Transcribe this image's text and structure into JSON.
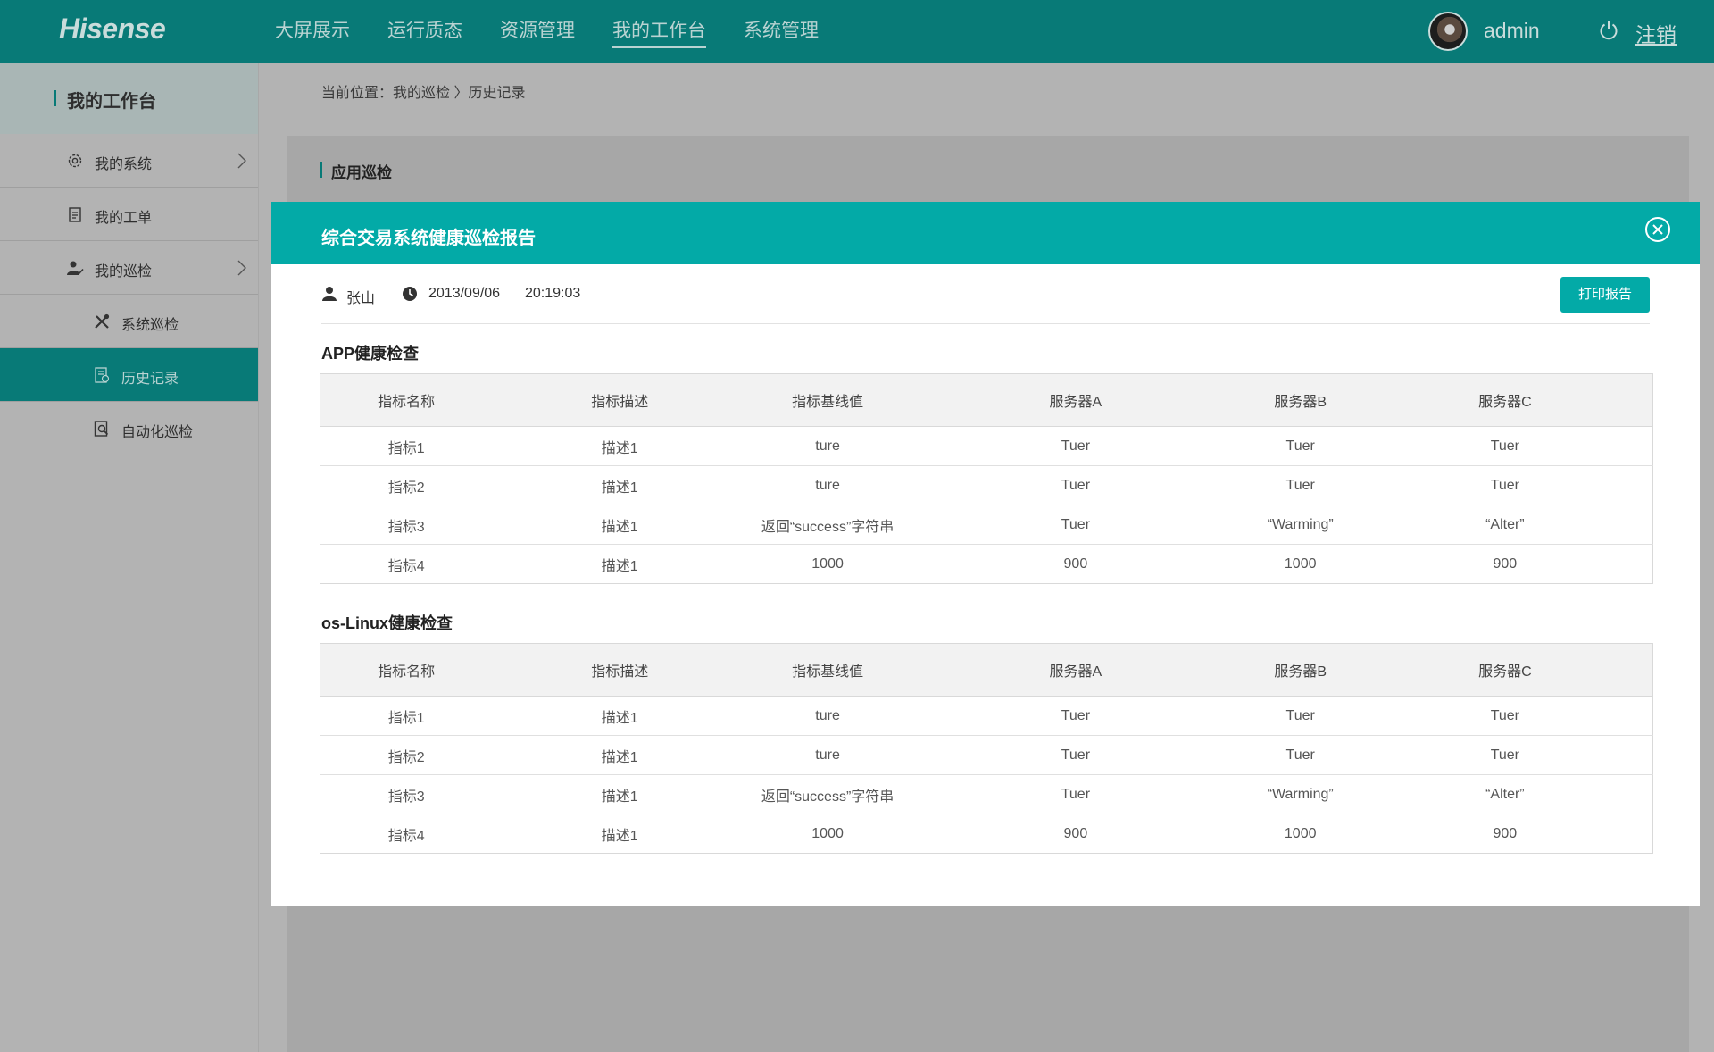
{
  "header": {
    "logo": "Hisense",
    "nav": [
      "大屏展示",
      "运行质态",
      "资源管理",
      "我的工作台",
      "系统管理"
    ],
    "active_nav": "我的工作台",
    "username": "admin",
    "logout": "注销"
  },
  "sidebar": {
    "title": "我的工作台",
    "items": [
      {
        "label": "我的系统",
        "icon": "gear-icon",
        "has_arrow": true
      },
      {
        "label": "我的工单",
        "icon": "clipboard-icon",
        "has_arrow": false
      },
      {
        "label": "我的巡检",
        "icon": "user-check-icon",
        "has_arrow": true
      },
      {
        "label": "系统巡检",
        "icon": "tools-icon",
        "has_arrow": false
      },
      {
        "label": "历史记录",
        "icon": "history-doc-icon",
        "has_arrow": false,
        "active": true
      },
      {
        "label": "自动化巡检",
        "icon": "doc-search-icon",
        "has_arrow": false
      }
    ]
  },
  "breadcrumb": "当前位置：我的巡检 〉历史记录",
  "panel": {
    "title": "应用巡检"
  },
  "modal": {
    "title": "综合交易系统健康巡检报告",
    "inspector": "张山",
    "date": "2013/09/06",
    "time": "20:19:03",
    "print_label": "打印报告",
    "sections": [
      {
        "title": "APP健康检查",
        "headers": [
          "指标名称",
          "指标描述",
          "指标基线值",
          "服务器A",
          "服务器B",
          "服务器C"
        ],
        "rows": [
          [
            "指标1",
            "描述1",
            "ture",
            "Tuer",
            "Tuer",
            "Tuer"
          ],
          [
            "指标2",
            "描述1",
            "ture",
            "Tuer",
            "Tuer",
            "Tuer"
          ],
          [
            "指标3",
            "描述1",
            "返回“success”字符串",
            "Tuer",
            "“Warming”",
            "“Alter”"
          ],
          [
            "指标4",
            "描述1",
            "1000",
            "900",
            "1000",
            "900"
          ]
        ]
      },
      {
        "title": "os-Linux健康检查",
        "headers": [
          "指标名称",
          "指标描述",
          "指标基线值",
          "服务器A",
          "服务器B",
          "服务器C"
        ],
        "rows": [
          [
            "指标1",
            "描述1",
            "ture",
            "Tuer",
            "Tuer",
            "Tuer"
          ],
          [
            "指标2",
            "描述1",
            "ture",
            "Tuer",
            "Tuer",
            "Tuer"
          ],
          [
            "指标3",
            "描述1",
            "返回“success”字符串",
            "Tuer",
            "“Warming”",
            "“Alter”"
          ],
          [
            "指标4",
            "描述1",
            "1000",
            "900",
            "1000",
            "900"
          ]
        ]
      }
    ]
  },
  "colors": {
    "brand": "#087a77",
    "accent": "#03aaa7"
  }
}
